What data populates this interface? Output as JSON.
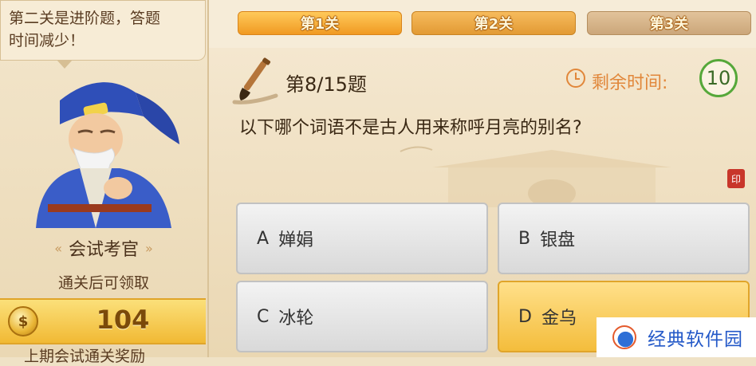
{
  "hint": {
    "line1": "第二关是进阶题，答题",
    "line2": "时间减少！"
  },
  "examiner": {
    "title": "会试考官",
    "left_ornament": "«",
    "right_ornament": "»"
  },
  "reward": {
    "label": "通关后可领取",
    "coin_glyph": "$",
    "coins": "104",
    "cut_text": "上期会试通关奖励"
  },
  "stages": [
    {
      "label": "第1关"
    },
    {
      "label": "第2关"
    },
    {
      "label": "第3关"
    }
  ],
  "quiz": {
    "progress": "第8/15题",
    "time_label": "剩余时间:",
    "time_left": "10",
    "question": "以下哪个词语不是古人用来称呼月亮的别名?",
    "seal_char": "印",
    "options": [
      {
        "letter": "A",
        "text": "婵娟"
      },
      {
        "letter": "B",
        "text": "银盘"
      },
      {
        "letter": "C",
        "text": "冰轮"
      },
      {
        "letter": "D",
        "text": "金乌"
      }
    ],
    "selected": "D"
  },
  "colors": {
    "accent_orange": "#f09a22",
    "timer_green": "#56a83a",
    "selected_gold": "#f4bd3c"
  },
  "watermark": {
    "text": "经典软件园"
  }
}
